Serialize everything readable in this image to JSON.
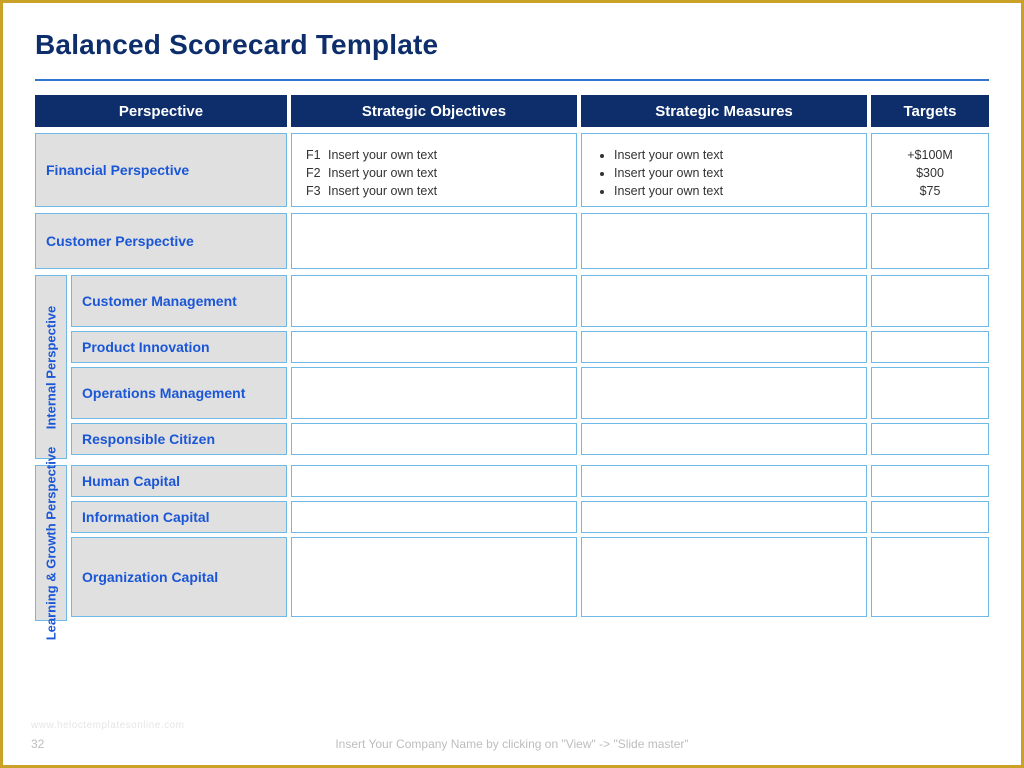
{
  "title": "Balanced Scorecard Template",
  "columns": {
    "perspective": "Perspective",
    "objectives": "Strategic Objectives",
    "measures": "Strategic Measures",
    "targets": "Targets"
  },
  "financial": {
    "label": "Financial Perspective",
    "objectives": [
      {
        "code": "F1",
        "text": "Insert your own text"
      },
      {
        "code": "F2",
        "text": "Insert your own text"
      },
      {
        "code": "F3",
        "text": "Insert your own text"
      }
    ],
    "measures": [
      "Insert your own text",
      "Insert your own text",
      "Insert your own text"
    ],
    "targets": [
      "+$100M",
      "$300",
      "$75"
    ]
  },
  "customer": {
    "label": "Customer Perspective"
  },
  "internal": {
    "group_label": "Internal Perspective",
    "rows": [
      "Customer Management",
      "Product Innovation",
      "Operations Management",
      "Responsible Citizen"
    ]
  },
  "learning": {
    "group_label": "Learning & Growth Perspective",
    "rows": [
      "Human Capital",
      "Information Capital",
      "Organization Capital"
    ]
  },
  "footer": "Insert Your Company Name by clicking on \"View\" -> \"Slide master\"",
  "page_number": "32",
  "watermark": "www.heloctemplatesonline.com"
}
